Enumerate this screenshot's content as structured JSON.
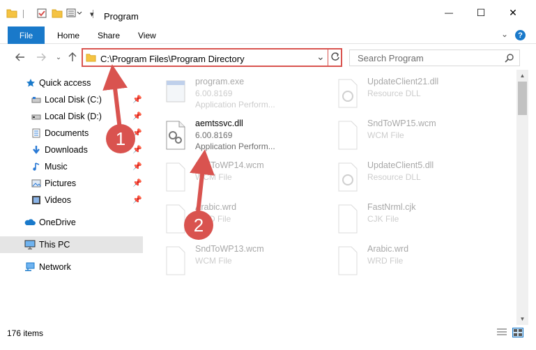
{
  "window": {
    "title": "Program",
    "minimize_glyph": "—",
    "maximize_glyph": "☐",
    "close_glyph": "✕"
  },
  "ribbon": {
    "tabs": [
      "File",
      "Home",
      "Share",
      "View"
    ],
    "help_glyph": "?"
  },
  "navigation": {
    "address": "C:\\Program Files\\Program Directory",
    "search_placeholder": "Search Program"
  },
  "sidebar": {
    "items": [
      {
        "label": "Quick access",
        "icon": "star-icon"
      },
      {
        "label": "Local Disk (C:)",
        "icon": "drive-icon",
        "pinned": true
      },
      {
        "label": "Local Disk (D:)",
        "icon": "drive-icon",
        "pinned": true
      },
      {
        "label": "Documents",
        "icon": "documents-icon",
        "pinned": true
      },
      {
        "label": "Downloads",
        "icon": "downloads-icon",
        "pinned": true
      },
      {
        "label": "Music",
        "icon": "music-icon",
        "pinned": true
      },
      {
        "label": "Pictures",
        "icon": "pictures-icon",
        "pinned": true
      },
      {
        "label": "Videos",
        "icon": "videos-icon",
        "pinned": true
      },
      {
        "label": "OneDrive",
        "icon": "onedrive-icon"
      },
      {
        "label": "This PC",
        "icon": "pc-icon",
        "selected": true
      },
      {
        "label": "Network",
        "icon": "network-icon"
      }
    ]
  },
  "files": [
    {
      "name": "program.exe",
      "line2": "6.00.8169",
      "line3": "Application Perform...",
      "faded": true
    },
    {
      "name": "UpdateClient21.dll",
      "line2": "Resource DLL",
      "line3": "",
      "faded": true
    },
    {
      "name": "aemtssvc.dll",
      "line2": "6.00.8169",
      "line3": "Application Perform...",
      "faded": false
    },
    {
      "name": "SndToWP15.wcm",
      "line2": "WCM File",
      "line3": "",
      "faded": true
    },
    {
      "name": "SndToWP14.wcm",
      "line2": "WCM File",
      "line3": "",
      "faded": true
    },
    {
      "name": "UpdateClient5.dll",
      "line2": "Resource DLL",
      "line3": "",
      "faded": true
    },
    {
      "name": "Arabic.wrd",
      "line2": "WRD File",
      "line3": "",
      "faded": true
    },
    {
      "name": "FastNrml.cjk",
      "line2": "CJK File",
      "line3": "",
      "faded": true
    },
    {
      "name": "SndToWP13.wcm",
      "line2": "WCM File",
      "line3": "",
      "faded": true
    },
    {
      "name": "Arabic.wrd",
      "line2": "WRD File",
      "line3": "",
      "faded": true
    }
  ],
  "status": {
    "item_count": "176 items"
  },
  "annotations": {
    "step1": "1",
    "step2": "2",
    "accent_color": "#d9534f"
  },
  "colors": {
    "file_tab": "#1979ca",
    "selection": "#e5e5e5"
  }
}
